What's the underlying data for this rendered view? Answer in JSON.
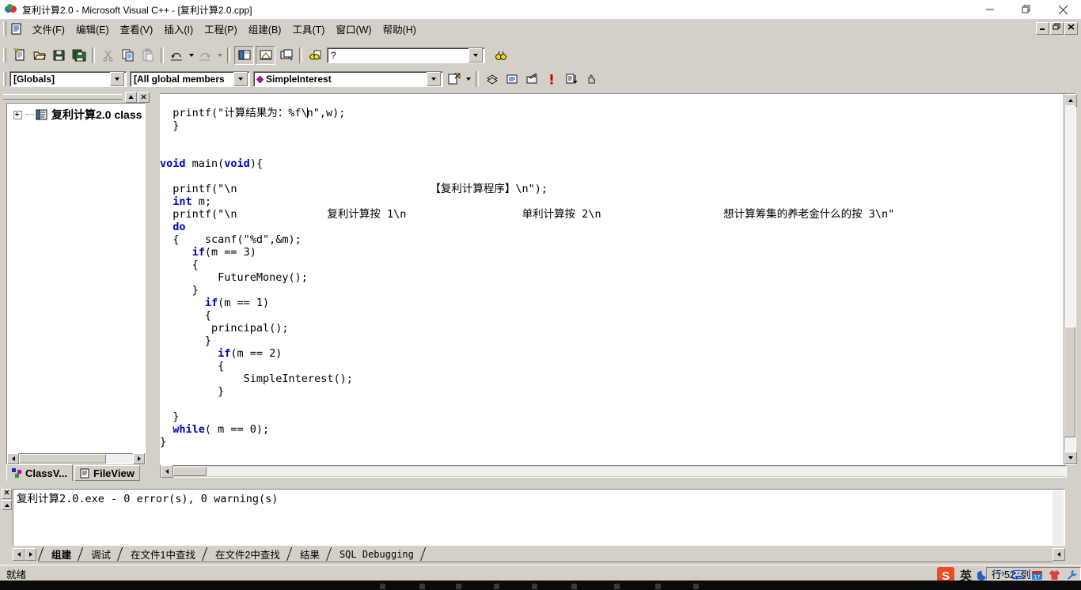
{
  "window": {
    "title": "复利计算2.0 - Microsoft Visual C++ - [复利计算2.0.cpp]",
    "app_icon": "vcpp-icon",
    "minimize": "—",
    "restore": "❐",
    "close": "✕",
    "mdi_minimize": "_",
    "mdi_restore": "❐",
    "mdi_close": "✕"
  },
  "menu": {
    "doc_icon": "document-icon",
    "items": [
      {
        "label": "文件(F)"
      },
      {
        "label": "编辑(E)"
      },
      {
        "label": "查看(V)"
      },
      {
        "label": "插入(I)"
      },
      {
        "label": "工程(P)"
      },
      {
        "label": "组建(B)"
      },
      {
        "label": "工具(T)"
      },
      {
        "label": "窗口(W)"
      },
      {
        "label": "帮助(H)"
      }
    ]
  },
  "toolbar_standard": {
    "buttons": [
      {
        "name": "new-text-file-button",
        "icon": "new-file-icon"
      },
      {
        "name": "open-button",
        "icon": "open-folder-icon"
      },
      {
        "name": "save-button",
        "icon": "floppy-save-icon"
      },
      {
        "name": "save-all-button",
        "icon": "floppy-save-all-icon"
      },
      {
        "name": "cut-button",
        "icon": "scissors-icon"
      },
      {
        "name": "copy-button",
        "icon": "copy-icon"
      },
      {
        "name": "paste-button",
        "icon": "paste-icon"
      },
      {
        "name": "undo-button",
        "icon": "undo-arrow-icon"
      },
      {
        "name": "redo-button",
        "icon": "redo-arrow-icon"
      },
      {
        "name": "workspace-button",
        "icon": "workspace-panel-icon"
      },
      {
        "name": "output-button",
        "icon": "output-panel-icon"
      },
      {
        "name": "window-list-button",
        "icon": "window-list-icon"
      },
      {
        "name": "find-in-files-button",
        "icon": "binoculars-files-icon"
      },
      {
        "name": "search-button",
        "icon": "binoculars-icon"
      }
    ],
    "find_combo_value": "?",
    "find_combo_placeholder": ""
  },
  "wizardbar": {
    "globals_combo": "[Globals]",
    "members_combo": "[All global members",
    "function_combo": "SimpleInterest",
    "function_icon": "member-diamond-icon",
    "action_buttons": [
      {
        "name": "wizardbar-actions-button",
        "icon": "wizard-actions-icon"
      },
      {
        "name": "goto-class-definition-button",
        "icon": "goto-class-icon"
      },
      {
        "name": "goto-function-definition-button",
        "icon": "goto-definition-icon"
      },
      {
        "name": "goto-function-declaration-button",
        "icon": "goto-declaration-icon"
      },
      {
        "name": "next-error-button",
        "icon": "exclamation-icon"
      },
      {
        "name": "insert-form-button",
        "icon": "insert-list-icon"
      },
      {
        "name": "hand-tool-button",
        "icon": "hand-icon"
      }
    ]
  },
  "workspace": {
    "close_button": "✕",
    "minimize_button": "▲",
    "tree": {
      "expander": "+",
      "icon": "class-folder-icon",
      "label": "复利计算2.0 class"
    },
    "tabs": [
      {
        "label": "ClassV...",
        "icon": "classview-icon",
        "active": true
      },
      {
        "label": "FileView",
        "icon": "fileview-icon",
        "active": false
      }
    ]
  },
  "editor": {
    "lines": [
      {
        "indent": 1,
        "tokens": [
          {
            "t": "code",
            "v": "  printf(\"计算结果为：%f\\"
          },
          {
            "t": "cursor",
            "v": ""
          },
          {
            "t": "code",
            "v": "n\",w);"
          }
        ]
      },
      {
        "indent": 1,
        "tokens": [
          {
            "t": "code",
            "v": "  }"
          }
        ]
      },
      {
        "indent": 0,
        "tokens": [
          {
            "t": "code",
            "v": ""
          }
        ]
      },
      {
        "indent": 0,
        "tokens": [
          {
            "t": "code",
            "v": ""
          }
        ]
      },
      {
        "indent": 0,
        "tokens": [
          {
            "t": "kw",
            "v": "void"
          },
          {
            "t": "code",
            "v": " main("
          },
          {
            "t": "kw",
            "v": "void"
          },
          {
            "t": "code",
            "v": "){"
          }
        ]
      },
      {
        "indent": 0,
        "tokens": [
          {
            "t": "code",
            "v": ""
          }
        ]
      },
      {
        "indent": 0,
        "tokens": [
          {
            "t": "code",
            "v": "  printf(\"\\n                              【复利计算程序】\\n\");"
          }
        ]
      },
      {
        "indent": 0,
        "tokens": [
          {
            "t": "kw2",
            "v": "  int"
          },
          {
            "t": "code",
            "v": " m;"
          }
        ]
      },
      {
        "indent": 0,
        "tokens": [
          {
            "t": "code",
            "v": "  printf(\"\\n              复利计算按 1\\n                  单利计算按 2\\n                   想计算筹集的养老金什么的按 3\\n\""
          }
        ]
      },
      {
        "indent": 0,
        "tokens": [
          {
            "t": "kw2",
            "v": "  do"
          }
        ]
      },
      {
        "indent": 0,
        "tokens": [
          {
            "t": "code",
            "v": "  {    scanf(\"%d\",&m);"
          }
        ]
      },
      {
        "indent": 0,
        "tokens": [
          {
            "t": "kw2",
            "v": "     if"
          },
          {
            "t": "code",
            "v": "(m == 3)"
          }
        ]
      },
      {
        "indent": 0,
        "tokens": [
          {
            "t": "code",
            "v": "     {"
          }
        ]
      },
      {
        "indent": 0,
        "tokens": [
          {
            "t": "code",
            "v": "         FutureMoney();"
          }
        ]
      },
      {
        "indent": 0,
        "tokens": [
          {
            "t": "code",
            "v": "     }"
          }
        ]
      },
      {
        "indent": 0,
        "tokens": [
          {
            "t": "kw2",
            "v": "       if"
          },
          {
            "t": "code",
            "v": "(m == 1)"
          }
        ]
      },
      {
        "indent": 0,
        "tokens": [
          {
            "t": "code",
            "v": "       {"
          }
        ]
      },
      {
        "indent": 0,
        "tokens": [
          {
            "t": "code",
            "v": "        principal();"
          }
        ]
      },
      {
        "indent": 0,
        "tokens": [
          {
            "t": "code",
            "v": "       }"
          }
        ]
      },
      {
        "indent": 0,
        "tokens": [
          {
            "t": "kw2",
            "v": "         if"
          },
          {
            "t": "code",
            "v": "(m == 2)"
          }
        ]
      },
      {
        "indent": 0,
        "tokens": [
          {
            "t": "code",
            "v": "         {"
          }
        ]
      },
      {
        "indent": 0,
        "tokens": [
          {
            "t": "code",
            "v": "             SimpleInterest();"
          }
        ]
      },
      {
        "indent": 0,
        "tokens": [
          {
            "t": "code",
            "v": "         }"
          }
        ]
      },
      {
        "indent": 0,
        "tokens": [
          {
            "t": "code",
            "v": ""
          }
        ]
      },
      {
        "indent": 0,
        "tokens": [
          {
            "t": "code",
            "v": "  }"
          }
        ]
      },
      {
        "indent": 0,
        "tokens": [
          {
            "t": "kw2",
            "v": "  while"
          },
          {
            "t": "code",
            "v": "( m == 0);"
          }
        ]
      },
      {
        "indent": 0,
        "tokens": [
          {
            "t": "code",
            "v": "}"
          }
        ]
      }
    ]
  },
  "output": {
    "close_button": "✕",
    "text": "复利计算2.0.exe - 0 error(s), 0 warning(s)",
    "tabs": [
      {
        "label": "组建",
        "active": true
      },
      {
        "label": "调试",
        "active": false
      },
      {
        "label": "在文件1中查找",
        "active": false
      },
      {
        "label": "在文件2中查找",
        "active": false
      },
      {
        "label": "结果",
        "active": false
      },
      {
        "label": "SQL Debugging",
        "active": false
      }
    ]
  },
  "statusbar": {
    "ready": "就绪",
    "position": "行 52, 列"
  },
  "ime": {
    "logo": "S",
    "mode": "英",
    "moon_icon": "moon-icon",
    "comma_icon": "punctuation-icon",
    "keyboard_icon": "keyboard-icon",
    "calendar_icon": "calendar-icon",
    "skin_icon": "shirt-icon",
    "tools_icon": "wrench-icon"
  },
  "colors": {
    "face": "#d4d0c8",
    "keyword": "#0000c0",
    "editor_bg": "#ffffff",
    "accent_red": "#f04b20"
  }
}
